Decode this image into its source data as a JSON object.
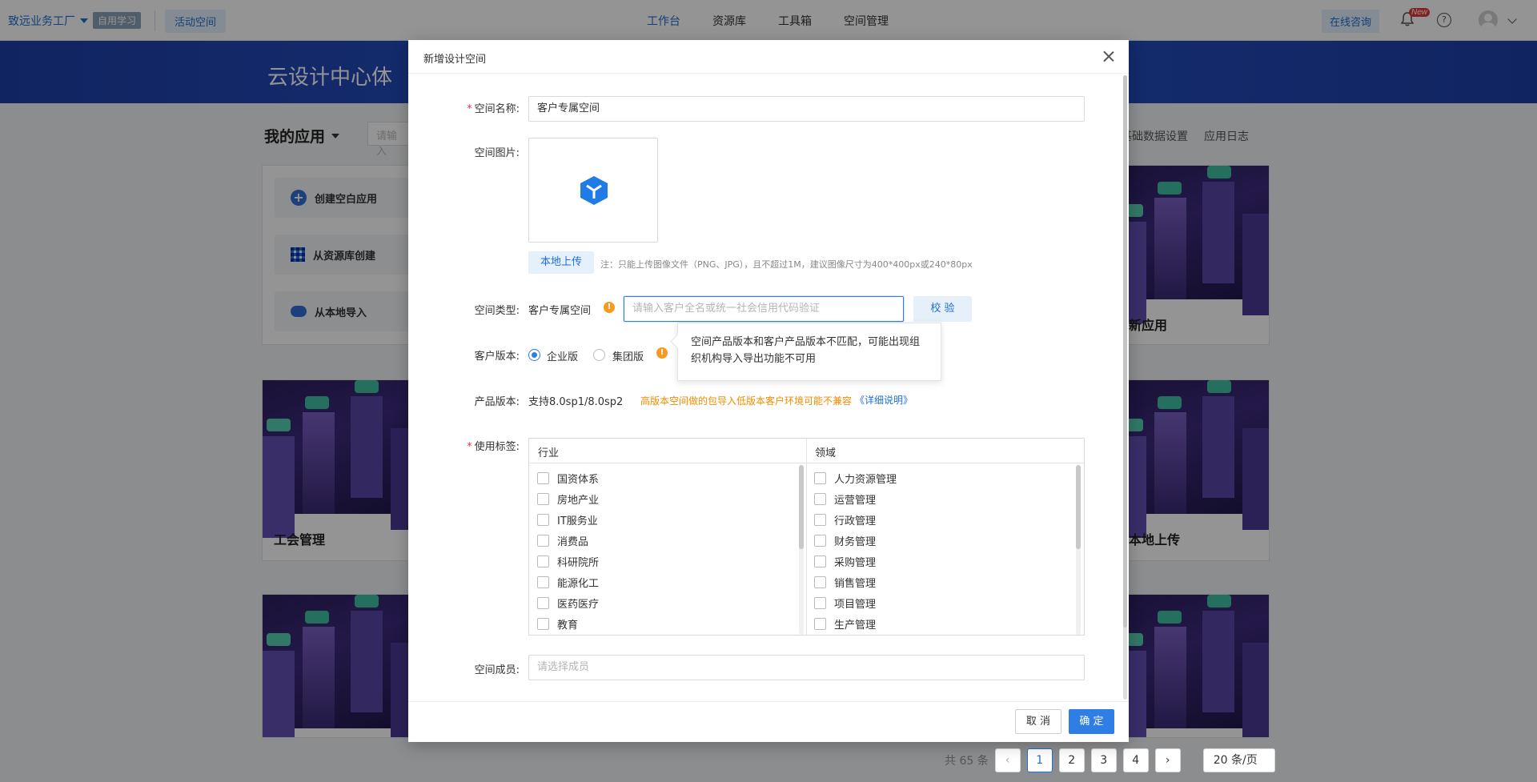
{
  "topnav": {
    "org_name": "致远业务工厂",
    "org_tag": "自用学习",
    "active_space": "活动空间",
    "menu": [
      "工作台",
      "资源库",
      "工具箱",
      "空间管理"
    ],
    "active_menu": "工作台",
    "consult": "在线咨询",
    "notify_badge": "New"
  },
  "banner": {
    "title": "云设计中心体"
  },
  "page": {
    "my_apps": "我的应用",
    "search_placeholder": "请输入",
    "links": [
      "基础数据设置",
      "应用日志"
    ],
    "create_items": [
      "创建空白应用",
      "从资源库创建",
      "从本地导入"
    ],
    "cards": [
      "工会管理",
      "新应用",
      "本地上传"
    ]
  },
  "pagination": {
    "total": "共 65 条",
    "pages": [
      "1",
      "2",
      "3",
      "4"
    ],
    "current": "1",
    "page_size": "20 条/页"
  },
  "dialog": {
    "title": "新增设计空间",
    "name_label": "空间名称:",
    "name_value": "客户专属空间",
    "image_label": "空间图片:",
    "upload_button": "本地上传",
    "upload_note": "注：只能上传图像文件（PNG、JPG），且不超过1M，建议图像尺寸为400*400px或240*80px",
    "type_label": "空间类型:",
    "type_value": "客户专属空间",
    "verify_placeholder": "请输入客户全名或统一社会信用代码验证",
    "verify_button": "校 验",
    "edition_label": "客户版本:",
    "editions": [
      "企业版",
      "集团版"
    ],
    "selected_edition": "企业版",
    "tooltip": "空间产品版本和客户产品版本不匹配，可能出现组织机构导入导出功能不可用",
    "product_label": "产品版本:",
    "product_value": "支持8.0sp1/8.0sp2",
    "product_warning": "高版本空间做的包导入低版本客户环境可能不兼容",
    "product_link": "《详细说明》",
    "tags_label": "使用标签:",
    "tag_columns": {
      "industry_title": "行业",
      "industry": [
        "国资体系",
        "房地产业",
        "IT服务业",
        "消费品",
        "科研院所",
        "能源化工",
        "医药医疗",
        "教育"
      ],
      "domain_title": "领域",
      "domain": [
        "人力资源管理",
        "运营管理",
        "行政管理",
        "财务管理",
        "采购管理",
        "销售管理",
        "项目管理",
        "生产管理"
      ]
    },
    "members_label": "空间成员:",
    "members_placeholder": "请选择成员",
    "cancel": "取 消",
    "ok": "确 定"
  },
  "colors": {
    "primary": "#2f7ee6",
    "warning": "#f08c00",
    "required": "#e5383b"
  }
}
